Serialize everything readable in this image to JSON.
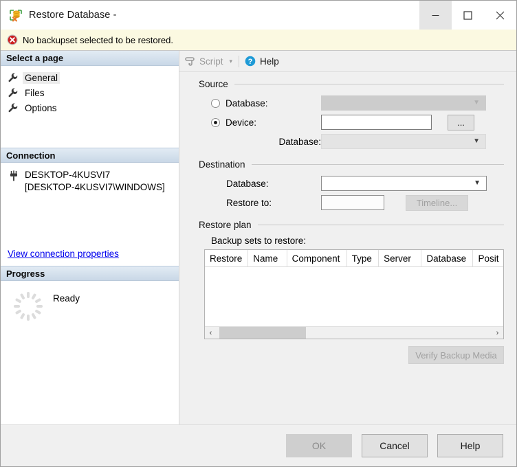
{
  "window": {
    "title": "Restore Database -",
    "app_icon": "database-restore-icon",
    "controls": {
      "minimize": "minimize-icon",
      "maximize": "maximize-icon",
      "close": "close-icon"
    }
  },
  "error_banner": {
    "icon": "error-icon",
    "message": "No backupset selected to be restored."
  },
  "sidebar": {
    "select_page_header": "Select a page",
    "pages": [
      {
        "label": "General",
        "icon": "wrench-icon",
        "selected": true
      },
      {
        "label": "Files",
        "icon": "wrench-icon",
        "selected": false
      },
      {
        "label": "Options",
        "icon": "wrench-icon",
        "selected": false
      }
    ],
    "connection_header": "Connection",
    "connection": {
      "icon": "plug-icon",
      "server": "DESKTOP-4KUSVI7",
      "user": "[DESKTOP-4KUSVI7\\WINDOWS]",
      "link": "View connection properties"
    },
    "progress_header": "Progress",
    "progress": {
      "icon": "spinner-icon",
      "status": "Ready"
    }
  },
  "toolbar": {
    "script_icon": "script-icon",
    "script_label": "Script",
    "script_caret": "▾",
    "help_icon": "help-icon",
    "help_label": "Help"
  },
  "source": {
    "group_label": "Source",
    "database_radio_label": "Database:",
    "database_radio_selected": false,
    "database_value": "",
    "device_radio_label": "Device:",
    "device_radio_selected": true,
    "device_value": "",
    "browse_button": "...",
    "device_database_label": "Database:",
    "device_database_value": ""
  },
  "destination": {
    "group_label": "Destination",
    "database_label": "Database:",
    "database_value": "",
    "restore_to_label": "Restore to:",
    "restore_to_value": "",
    "timeline_button": "Timeline..."
  },
  "restore_plan": {
    "group_label": "Restore plan",
    "table_label": "Backup sets to restore:",
    "columns": [
      "Restore",
      "Name",
      "Component",
      "Type",
      "Server",
      "Database",
      "Posit"
    ],
    "rows": [],
    "scroll_left_arrow": "‹",
    "scroll_right_arrow": "›",
    "verify_button": "Verify Backup Media"
  },
  "footer": {
    "ok": "OK",
    "cancel": "Cancel",
    "help": "Help"
  },
  "colors": {
    "error_banner_bg": "#fbf9e1",
    "section_header_top": "#e2ebf4",
    "section_header_bottom": "#c9d8e7",
    "link": "#0000ee",
    "dialog_bg": "#f0f0f0"
  }
}
